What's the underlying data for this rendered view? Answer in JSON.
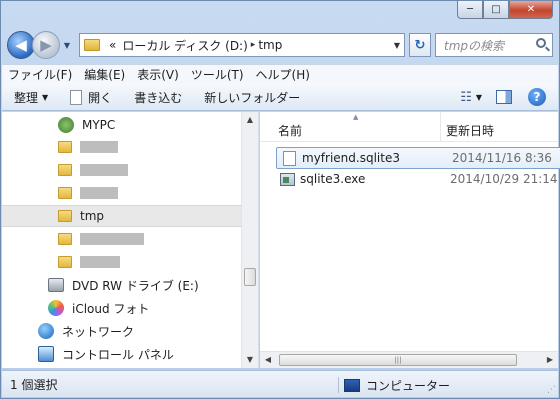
{
  "window": {
    "caption_buttons": {
      "minimize": "─",
      "maximize": "□",
      "close": "✕"
    }
  },
  "nav": {
    "back_glyph": "◀",
    "forward_glyph": "▶",
    "history_glyph": "▼"
  },
  "address": {
    "overflow": "«",
    "path": [
      "ローカル ディスク (D:)",
      "tmp"
    ],
    "separator": "▸",
    "dropdown": "▼"
  },
  "refresh_glyph": "↻",
  "search": {
    "placeholder": "tmpの検索"
  },
  "menu": [
    "ファイル(F)",
    "編集(E)",
    "表示(V)",
    "ツール(T)",
    "ヘルプ(H)"
  ],
  "toolbar": {
    "organize": "整理",
    "open": "開く",
    "burn": "書き込む",
    "new_folder": "新しいフォルダー",
    "help": "?"
  },
  "tree": {
    "mypc": "MYPC",
    "tmp": "tmp",
    "dvd": "DVD RW ドライブ (E:)",
    "icloud": "iCloud フォト",
    "network": "ネットワーク",
    "control_panel": "コントロール パネル"
  },
  "columns": {
    "name": "名前",
    "date": "更新日時"
  },
  "files": [
    {
      "name": "myfriend.sqlite3",
      "date": "2014/11/16 8:36"
    },
    {
      "name": "sqlite3.exe",
      "date": "2014/10/29 21:14"
    }
  ],
  "status": {
    "count": "1 個選択",
    "location": "コンピューター"
  },
  "colors": {
    "accent": "#2a6ac0",
    "selection_border": "#7da2ce"
  }
}
